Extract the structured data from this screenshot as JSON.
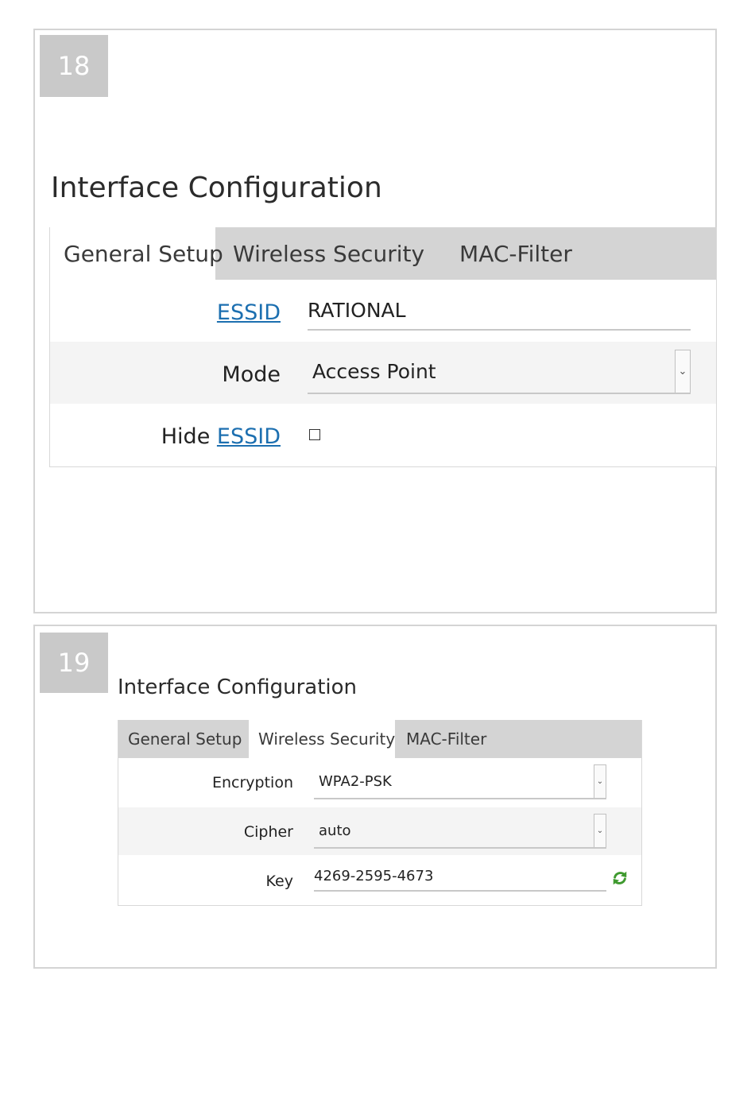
{
  "step18": {
    "badge": "18",
    "title": "Interface Configuration",
    "tabs": [
      "General Setup",
      "Wireless Security",
      "MAC-Filter"
    ],
    "active_tab": "General Setup",
    "fields": {
      "essid_label": "ESSID",
      "essid_value": "RATIONAL",
      "mode_label": "Mode",
      "mode_value": "Access Point",
      "hide_label_prefix": "Hide",
      "hide_label_link": "ESSID",
      "hide_checked": false
    }
  },
  "step19": {
    "badge": "19",
    "title": "Interface Configuration",
    "tabs": [
      "General Setup",
      "Wireless Security",
      "MAC-Filter"
    ],
    "active_tab": "Wireless Security",
    "fields": {
      "encryption_label": "Encryption",
      "encryption_value": "WPA2-PSK",
      "cipher_label": "Cipher",
      "cipher_value": "auto",
      "key_label": "Key",
      "key_value": "4269-2595-4673"
    }
  },
  "icons": {
    "select_arrow": "chevron-down-icon",
    "refresh": "refresh-icon"
  },
  "colors": {
    "badge_bg": "#c9c9c9",
    "tabbar_bg": "#d4d4d4",
    "link": "#1c6fb0",
    "refresh_icon": "#3f9a2f"
  }
}
